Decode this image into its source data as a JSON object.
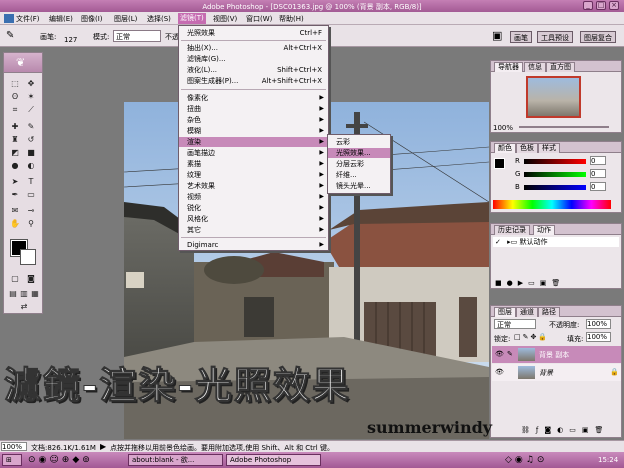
{
  "window": {
    "title": "Adobe Photoshop - [DSC01363.jpg @ 100% (背景 副本, RGB/8)]",
    "min": "_",
    "max": "□",
    "close": "×"
  },
  "menubar": [
    "文件(F)",
    "编辑(E)",
    "图像(I)",
    "图层(L)",
    "选择(S)",
    "滤镜(T)",
    "视图(V)",
    "窗口(W)",
    "帮助(H)"
  ],
  "options": {
    "brush_label": "画笔:",
    "brush_size": "127",
    "mode_label": "模式:",
    "mode_value": "正常",
    "opacity_label": "不透",
    "palette_tabs": [
      "画笔",
      "工具预设",
      "图层复合"
    ]
  },
  "filter_menu": {
    "items": [
      {
        "label": "光照效果",
        "shortcut": "Ctrl+F"
      },
      {
        "label": "抽出(X)...",
        "shortcut": "Alt+Ctrl+X"
      },
      {
        "label": "滤镜库(G)...",
        "shortcut": ""
      },
      {
        "label": "液化(L)...",
        "shortcut": "Shift+Ctrl+X"
      },
      {
        "label": "图案生成器(P)...",
        "shortcut": "Alt+Shift+Ctrl+X"
      },
      {
        "label": "像素化"
      },
      {
        "label": "扭曲"
      },
      {
        "label": "杂色"
      },
      {
        "label": "模糊"
      },
      {
        "label": "渲染"
      },
      {
        "label": "画笔描边"
      },
      {
        "label": "素描"
      },
      {
        "label": "纹理"
      },
      {
        "label": "艺术效果"
      },
      {
        "label": "视频"
      },
      {
        "label": "锐化"
      },
      {
        "label": "风格化"
      },
      {
        "label": "其它"
      },
      {
        "label": "Digimarc"
      }
    ]
  },
  "render_submenu": [
    "云彩",
    "光照效果...",
    "分层云彩",
    "纤维...",
    "镜头光晕..."
  ],
  "navigator": {
    "tabs": [
      "导航器",
      "信息",
      "直方图"
    ],
    "zoom": "100%"
  },
  "color": {
    "tabs": [
      "颜色",
      "色板",
      "样式"
    ],
    "r_label": "R",
    "g_label": "G",
    "b_label": "B",
    "r": "0",
    "g": "0",
    "b": "0"
  },
  "history": {
    "tabs": [
      "历史记录",
      "动作"
    ],
    "item": "默认动作"
  },
  "layers": {
    "tabs": [
      "图层",
      "通道",
      "路径"
    ],
    "blend": "正常",
    "opacity_label": "不透明度:",
    "opacity": "100%",
    "lock_label": "锁定:",
    "fill_label": "填充:",
    "fill": "100%",
    "rows": [
      {
        "name": "背景 副本"
      },
      {
        "name": "背景"
      }
    ]
  },
  "status": {
    "zoom": "100%",
    "doc": "文档:826.1K/1.61M",
    "hint": "点按并拖移以用前景色绘画。要用附加选项,使用 Shift、Alt 和 Ctrl 键。"
  },
  "taskbar": {
    "items": [
      "about:blank - 欲...",
      "Adobe Photoshop"
    ],
    "time": "15:24"
  },
  "caption": "濾鏡-渲染-光照效果",
  "signature": "summerwindy",
  "colors": {
    "accent": "#c66cb1",
    "title": "#a35a94"
  }
}
